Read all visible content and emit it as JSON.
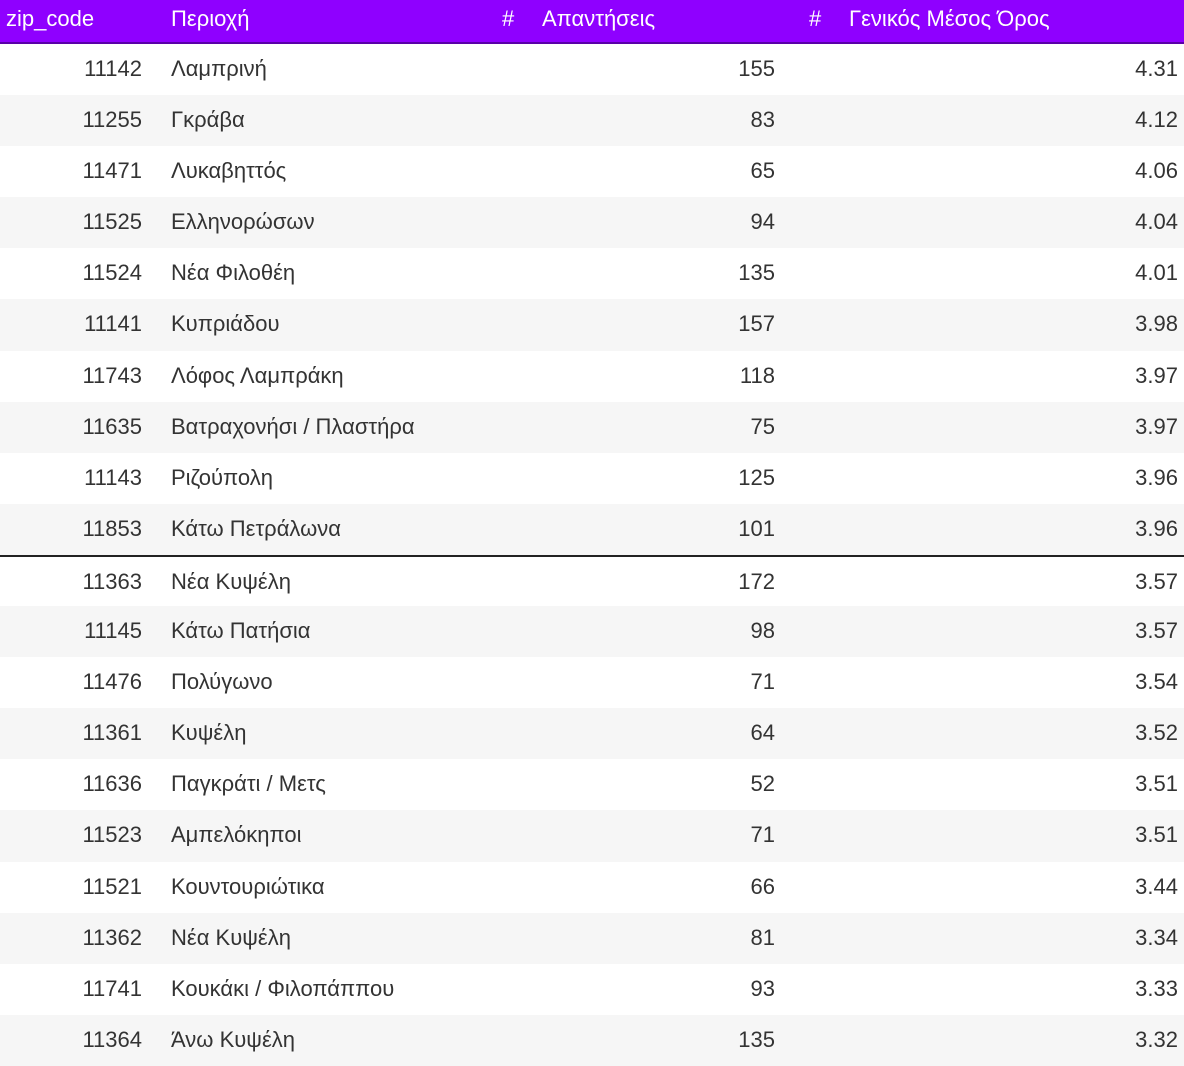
{
  "header": {
    "zip_label": "zip_code",
    "area_label": "Περιοχή",
    "responses_hash": "#",
    "responses_label": "Απαντήσεις",
    "avg_hash": "#",
    "avg_label": "Γενικός Μέσος Όρος"
  },
  "colors": {
    "header_bg": "#8f00ff",
    "header_text": "#ffffff",
    "row_alt_bg": "#f6f6f6"
  },
  "rows": [
    {
      "zip": "11142",
      "area": "Λαμπρινή",
      "responses": "155",
      "avg": "4.31"
    },
    {
      "zip": "11255",
      "area": "Γκράβα",
      "responses": "83",
      "avg": "4.12"
    },
    {
      "zip": "11471",
      "area": "Λυκαβηττός",
      "responses": "65",
      "avg": "4.06"
    },
    {
      "zip": "11525",
      "area": "Ελληνορώσων",
      "responses": "94",
      "avg": "4.04"
    },
    {
      "zip": "11524",
      "area": "Νέα Φιλοθέη",
      "responses": "135",
      "avg": "4.01"
    },
    {
      "zip": "11141",
      "area": "Κυπριάδου",
      "responses": "157",
      "avg": "3.98"
    },
    {
      "zip": "11743",
      "area": "Λόφος Λαμπράκη",
      "responses": "118",
      "avg": "3.97"
    },
    {
      "zip": "11635",
      "area": "Βατραχονήσι / Πλαστήρα",
      "responses": "75",
      "avg": "3.97"
    },
    {
      "zip": "11143",
      "area": "Ριζούπολη",
      "responses": "125",
      "avg": "3.96"
    },
    {
      "zip": "11853",
      "area": "Κάτω Πετράλωνα",
      "responses": "101",
      "avg": "3.96"
    },
    {
      "zip": "11363",
      "area": "Νέα Κυψέλη",
      "responses": "172",
      "avg": "3.57"
    },
    {
      "zip": "11145",
      "area": "Κάτω Πατήσια",
      "responses": "98",
      "avg": "3.57"
    },
    {
      "zip": "11476",
      "area": "Πολύγωνο",
      "responses": "71",
      "avg": "3.54"
    },
    {
      "zip": "11361",
      "area": "Κυψέλη",
      "responses": "64",
      "avg": "3.52"
    },
    {
      "zip": "11636",
      "area": "Παγκράτι / Μετς",
      "responses": "52",
      "avg": "3.51"
    },
    {
      "zip": "11523",
      "area": "Αμπελόκηποι",
      "responses": "71",
      "avg": "3.51"
    },
    {
      "zip": "11521",
      "area": "Κουντουριώτικα",
      "responses": "66",
      "avg": "3.44"
    },
    {
      "zip": "11362",
      "area": "Νέα Κυψέλη",
      "responses": "81",
      "avg": "3.34"
    },
    {
      "zip": "11741",
      "area": "Κουκάκι / Φιλοπάππου",
      "responses": "93",
      "avg": "3.33"
    },
    {
      "zip": "11364",
      "area": "Άνω Κυψέλη",
      "responses": "135",
      "avg": "3.32"
    }
  ]
}
